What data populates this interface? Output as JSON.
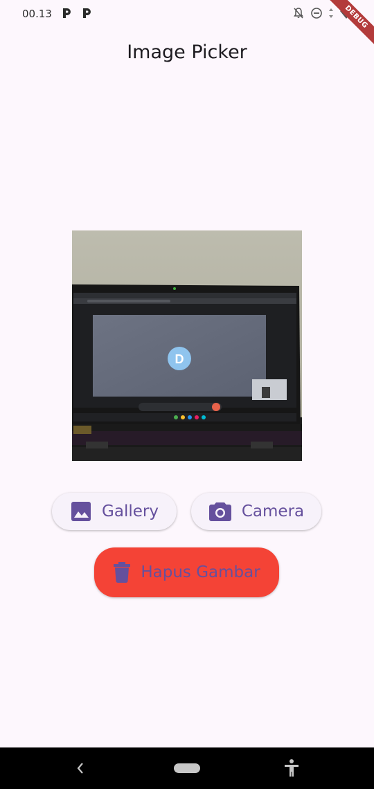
{
  "status_bar": {
    "time": "00.13",
    "notification_icons": [
      "parking-app-icon",
      "parking-app-icon"
    ],
    "system_icons": [
      "notifications-off-icon",
      "do-not-disturb-icon",
      "data-arrows-icon",
      "wifi-icon"
    ]
  },
  "debug_banner": {
    "label": "DEBUG"
  },
  "app_bar": {
    "title": "Image Picker"
  },
  "picked_image": {
    "description_icon": "photo-of-laptop-screen",
    "avatar_letter": "D"
  },
  "buttons": {
    "gallery": {
      "label": "Gallery",
      "icon": "image-icon"
    },
    "camera": {
      "label": "Camera",
      "icon": "camera-icon"
    },
    "delete": {
      "label": "Hapus Gambar",
      "icon": "trash-icon"
    }
  },
  "colors": {
    "background": "#fdf7fd",
    "button_text": "#65509d",
    "delete_button": "#f44336",
    "nav_bar": "#000000"
  },
  "nav_bar": {
    "icons": [
      "back-icon",
      "home-pill-icon",
      "accessibility-icon"
    ]
  }
}
